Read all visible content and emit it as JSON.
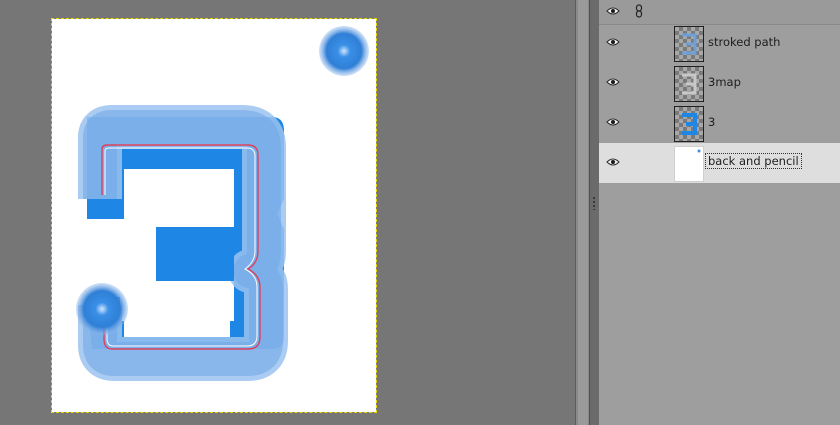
{
  "layers_panel": {
    "header": {
      "visibility_icon": "eye-icon",
      "chain_icon": "chain-link-icon"
    },
    "layers": [
      {
        "name": "stroked path",
        "visible": true,
        "thumbnail": "checker-3-outline"
      },
      {
        "name": "3map",
        "visible": true,
        "thumbnail": "checker-3-outline-gray"
      },
      {
        "name": "3",
        "visible": true,
        "thumbnail": "checker-3-blue"
      },
      {
        "name": "back and pencil",
        "visible": true,
        "selected": true,
        "thumbnail": "white"
      }
    ]
  },
  "colors": {
    "digit_blue": "#1e86e4",
    "stroke_blue": "#7fb2ea",
    "path_red": "#e0405a",
    "selection_bg": "#dedede",
    "canvas_bg": "#ffffff"
  }
}
